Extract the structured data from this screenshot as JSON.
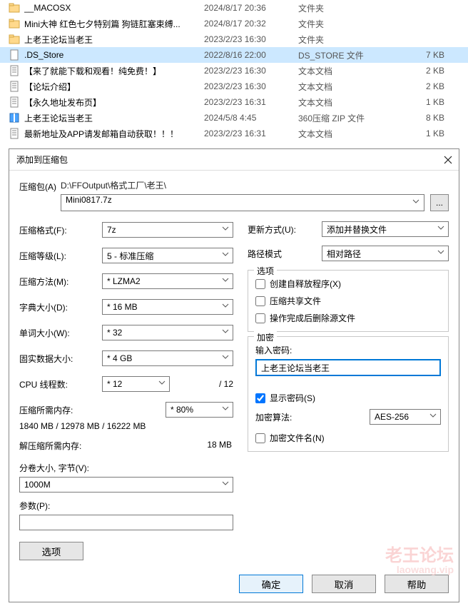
{
  "file_list": [
    {
      "name": "__MACOSX",
      "date": "2024/8/17 20:36",
      "type": "文件夹",
      "size": ""
    },
    {
      "name": "Mini大神 红色七夕特别篇 狗链肛塞束缚...",
      "date": "2024/8/17 20:32",
      "type": "文件夹",
      "size": ""
    },
    {
      "name": "上老王论坛当老王",
      "date": "2023/2/23 16:30",
      "type": "文件夹",
      "size": ""
    },
    {
      "name": ".DS_Store",
      "date": "2022/8/16 22:00",
      "type": "DS_STORE 文件",
      "size": "7 KB"
    },
    {
      "name": "【来了就能下载和观看！纯免费！】",
      "date": "2023/2/23 16:30",
      "type": "文本文档",
      "size": "2 KB"
    },
    {
      "name": "【论坛介绍】",
      "date": "2023/2/23 16:30",
      "type": "文本文档",
      "size": "2 KB"
    },
    {
      "name": "【永久地址发布页】",
      "date": "2023/2/23 16:31",
      "type": "文本文档",
      "size": "1 KB"
    },
    {
      "name": "上老王论坛当老王",
      "date": "2024/5/8 4:45",
      "type": "360压缩 ZIP 文件",
      "size": "8 KB"
    },
    {
      "name": "最新地址及APP请发邮箱自动获取！！！",
      "date": "2023/2/23 16:31",
      "type": "文本文档",
      "size": "1 KB"
    }
  ],
  "dialog": {
    "title": "添加到压缩包",
    "archive_label": "压缩包(A)",
    "path": "D:\\FFOutput\\格式工厂\\老王\\",
    "archive_name": "Mini0817.7z",
    "browse": "...",
    "left": {
      "format_label": "压缩格式(F):",
      "format": "7z",
      "level_label": "压缩等级(L):",
      "level": "5 - 标准压缩",
      "method_label": "压缩方法(M):",
      "method": "*  LZMA2",
      "dict_label": "字典大小(D):",
      "dict": "*  16 MB",
      "word_label": "单词大小(W):",
      "word": "*  32",
      "solid_label": "固实数据大小:",
      "solid": "*  4 GB",
      "threads_label": "CPU 线程数:",
      "threads": "*  12",
      "threads_max": "/ 12",
      "mem_c_label": "压缩所需内存:",
      "mem_select": "*  80%",
      "mem_c": "1840 MB / 12978 MB / 16222 MB",
      "mem_d_label": "解压缩所需内存:",
      "mem_d": "18 MB",
      "split_label": "分卷大小, 字节(V):",
      "split": "1000M",
      "params_label": "参数(P):",
      "params": "",
      "options": "选项"
    },
    "right": {
      "update_label": "更新方式(U):",
      "update": "添加并替换文件",
      "pathmode_label": "路径模式",
      "pathmode": "相对路径",
      "opt_group": "选项",
      "sfx": "创建自释放程序(X)",
      "shared": "压缩共享文件",
      "delete": "操作完成后删除源文件",
      "enc_group": "加密",
      "pwd_label": "输入密码:",
      "pwd": "上老王论坛当老王",
      "showpwd": "显示密码(S)",
      "alg_label": "加密算法:",
      "alg": "AES-256",
      "encname": "加密文件名(N)"
    },
    "buttons": {
      "ok": "确定",
      "cancel": "取消",
      "help": "帮助"
    },
    "watermark": {
      "l1": "老王论坛",
      "l2": "laowang.vip"
    }
  },
  "icons": {
    "folder": "folder",
    "text": "text",
    "dsstore": "blank",
    "zip": "zip"
  }
}
